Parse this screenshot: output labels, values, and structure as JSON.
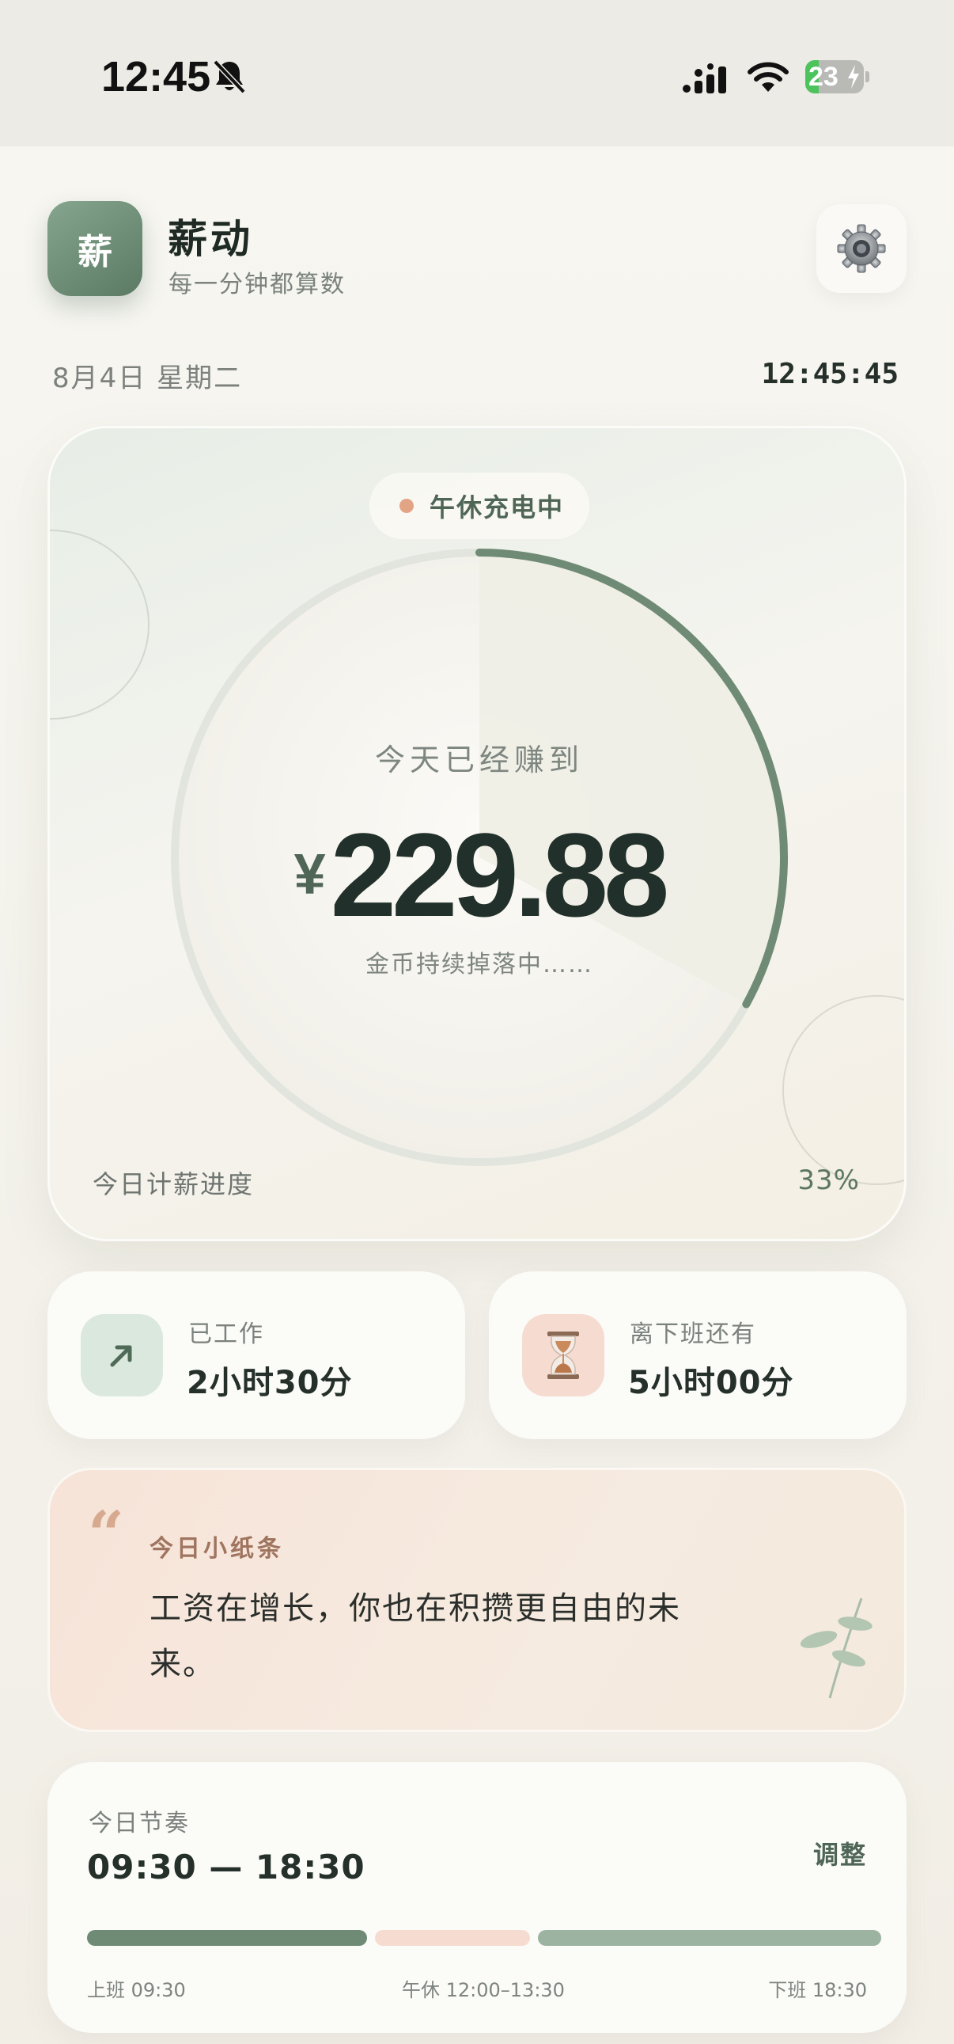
{
  "status_bar": {
    "time": "12:45",
    "battery": "23",
    "battery_level": 0.23,
    "icons": [
      "bell-slash-icon",
      "signal-icon",
      "wifi-icon",
      "battery-icon",
      "bolt-icon"
    ]
  },
  "header": {
    "logo_char": "薪",
    "app_name": "薪动",
    "tagline": "每一分钟都算数",
    "settings_icon": "gear-icon"
  },
  "date_line": "8月4日 星期二",
  "clock": "12:45:45",
  "earnings": {
    "status": "午休充电中",
    "label": "今天已经赚到",
    "currency": "¥",
    "amount": "229.88",
    "subtitle": "金币持续掉落中……",
    "progress_label": "今日计薪进度",
    "progress_text": "33%",
    "progress_fraction": 0.33
  },
  "stats": [
    {
      "label": "已工作",
      "value": "2小时30分",
      "icon": "arrow-up-right-icon"
    },
    {
      "label": "离下班还有",
      "value": "5小时00分",
      "icon": "hourglass-icon"
    }
  ],
  "note": {
    "quote_mark": "“",
    "title": "今日小纸条",
    "text": "工资在增长，你也在积攒更自由的未来。",
    "icon": "leaf-icon"
  },
  "rhythm": {
    "label": "今日节奏",
    "range": "09:30 — 18:30",
    "adjust": "调整",
    "ticks": {
      "start": "上班 09:30",
      "lunch": "午休 12:00–13:30",
      "end": "下班 18:30"
    }
  },
  "colors": {
    "accent": "#6f8b75",
    "accent_light": "#9cb3a1",
    "lunch": "#f6dcd0",
    "track": "#e1e5dd",
    "status_dot": "#e3a486",
    "battery_green": "#4cc35c"
  }
}
